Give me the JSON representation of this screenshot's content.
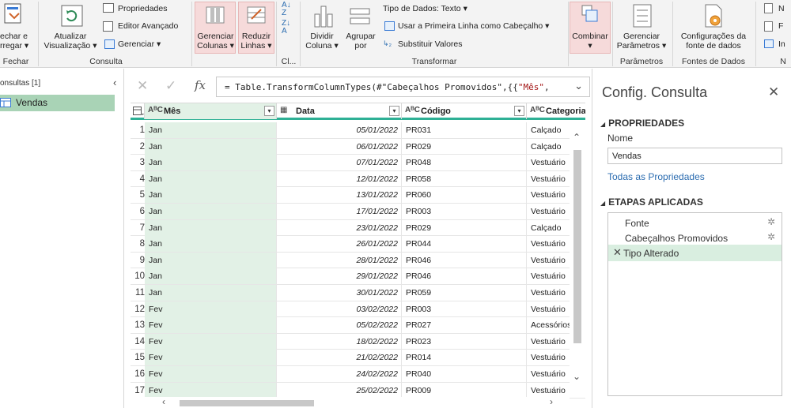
{
  "ribbon": {
    "fechar_label_1": "echar e",
    "fechar_label_2": "rregar",
    "fechar_group": "Fechar",
    "atualizar_label_1": "Atualizar",
    "atualizar_label_2": "Visualização",
    "propriedades": "Propriedades",
    "editor_avancado": "Editor Avançado",
    "gerenciar": "Gerenciar",
    "consulta_group": "Consulta",
    "gerenciar_colunas_1": "Gerenciar",
    "gerenciar_colunas_2": "Colunas",
    "reduzir_linhas_1": "Reduzir",
    "reduzir_linhas_2": "Linhas",
    "classificar_group": "Cl...",
    "dividir_coluna_1": "Dividir",
    "dividir_coluna_2": "Coluna",
    "agrupar_por_1": "Agrupar",
    "agrupar_por_2": "por",
    "tipo_dados": "Tipo de Dados: Texto",
    "usar_primeira_linha": "Usar a Primeira Linha como Cabeçalho",
    "substituir_valores": "Substituir Valores",
    "transformar_group": "Transformar",
    "combinar": "Combinar",
    "gerenciar_parametros_1": "Gerenciar",
    "gerenciar_parametros_2": "Parâmetros",
    "parametros_group": "Parâmetros",
    "config_fonte_1": "Configurações da",
    "config_fonte_2": "fonte de dados",
    "fontes_group": "Fontes de Dados",
    "n_group": "N",
    "nova_fonte": "N",
    "fontes_recentes": "F",
    "inserir_dados": "In"
  },
  "queries": {
    "title": "onsultas [1]",
    "collapse": "‹",
    "items": [
      {
        "label": "Vendas"
      }
    ]
  },
  "formula": {
    "prefix": "= Table.TransformColumnTypes(#\"Cabeçalhos Promovidos\",{{",
    "string": "\"Mês\"",
    "suffix": ","
  },
  "grid": {
    "columns": [
      {
        "type": "AᴮC",
        "name": "Mês"
      },
      {
        "type": "▦",
        "name": "Data"
      },
      {
        "type": "AᴮC",
        "name": "Código"
      },
      {
        "type": "AᴮC",
        "name": "Categoria"
      }
    ],
    "rows": [
      {
        "n": "1",
        "mes": "Jan",
        "data": "05/01/2022",
        "codigo": "PR031",
        "categoria": "Calçado"
      },
      {
        "n": "2",
        "mes": "Jan",
        "data": "06/01/2022",
        "codigo": "PR029",
        "categoria": "Calçado"
      },
      {
        "n": "3",
        "mes": "Jan",
        "data": "07/01/2022",
        "codigo": "PR048",
        "categoria": "Vestuário"
      },
      {
        "n": "4",
        "mes": "Jan",
        "data": "12/01/2022",
        "codigo": "PR058",
        "categoria": "Vestuário"
      },
      {
        "n": "5",
        "mes": "Jan",
        "data": "13/01/2022",
        "codigo": "PR060",
        "categoria": "Vestuário"
      },
      {
        "n": "6",
        "mes": "Jan",
        "data": "17/01/2022",
        "codigo": "PR003",
        "categoria": "Vestuário"
      },
      {
        "n": "7",
        "mes": "Jan",
        "data": "23/01/2022",
        "codigo": "PR029",
        "categoria": "Calçado"
      },
      {
        "n": "8",
        "mes": "Jan",
        "data": "26/01/2022",
        "codigo": "PR044",
        "categoria": "Vestuário"
      },
      {
        "n": "9",
        "mes": "Jan",
        "data": "28/01/2022",
        "codigo": "PR046",
        "categoria": "Vestuário"
      },
      {
        "n": "10",
        "mes": "Jan",
        "data": "29/01/2022",
        "codigo": "PR046",
        "categoria": "Vestuário"
      },
      {
        "n": "11",
        "mes": "Jan",
        "data": "30/01/2022",
        "codigo": "PR059",
        "categoria": "Vestuário"
      },
      {
        "n": "12",
        "mes": "Fev",
        "data": "03/02/2022",
        "codigo": "PR003",
        "categoria": "Vestuário"
      },
      {
        "n": "13",
        "mes": "Fev",
        "data": "05/02/2022",
        "codigo": "PR027",
        "categoria": "Acessórios"
      },
      {
        "n": "14",
        "mes": "Fev",
        "data": "18/02/2022",
        "codigo": "PR023",
        "categoria": "Vestuário"
      },
      {
        "n": "15",
        "mes": "Fev",
        "data": "21/02/2022",
        "codigo": "PR014",
        "categoria": "Vestuário"
      },
      {
        "n": "16",
        "mes": "Fev",
        "data": "24/02/2022",
        "codigo": "PR040",
        "categoria": "Vestuário"
      },
      {
        "n": "17",
        "mes": "Fev",
        "data": "25/02/2022",
        "codigo": "PR009",
        "categoria": "Vestuário"
      }
    ]
  },
  "config": {
    "title": "Config. Consulta",
    "close": "✕",
    "propriedades": "PROPRIEDADES",
    "nome_label": "Nome",
    "nome_value": "Vendas",
    "todas_propriedades": "Todas as Propriedades",
    "etapas": "ETAPAS APLICADAS",
    "steps": [
      {
        "label": "Fonte"
      },
      {
        "label": "Cabeçalhos Promovidos"
      },
      {
        "label": "Tipo Alterado"
      }
    ]
  },
  "colors": {
    "accent_green": "#2eb095",
    "selected_query": "#a9d3b6",
    "selected_column": "#e2f1e6",
    "highlight_pink": "#f6dada",
    "link_blue": "#2b6cb0"
  }
}
